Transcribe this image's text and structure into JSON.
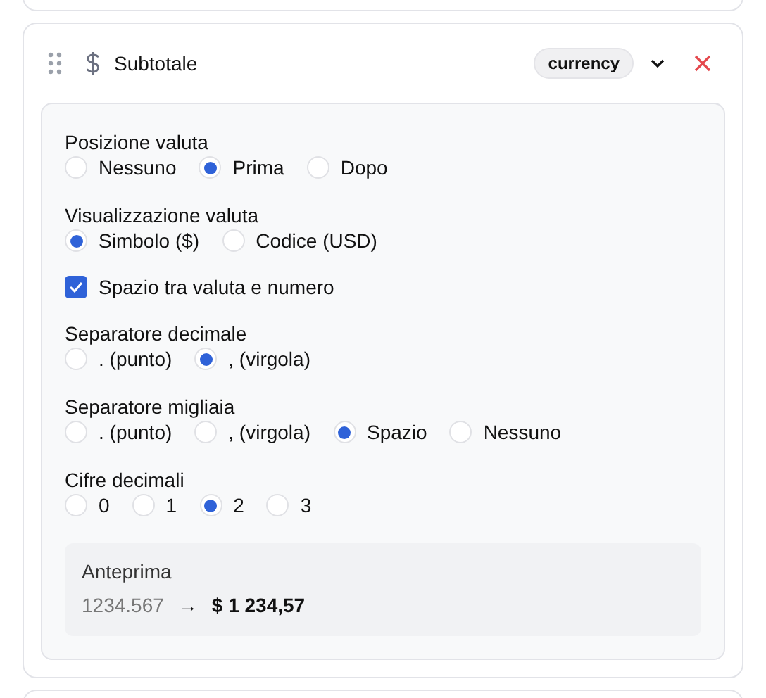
{
  "field": {
    "title": "Subtotale",
    "type_badge": "currency"
  },
  "settings": [
    {
      "kind": "radio",
      "label": "Posizione valuta",
      "options": [
        {
          "label": "Nessuno",
          "selected": false
        },
        {
          "label": "Prima",
          "selected": true
        },
        {
          "label": "Dopo",
          "selected": false
        }
      ]
    },
    {
      "kind": "radio",
      "label": "Visualizzazione valuta",
      "options": [
        {
          "label": "Simbolo ($)",
          "selected": true
        },
        {
          "label": "Codice (USD)",
          "selected": false
        }
      ]
    },
    {
      "kind": "checkbox",
      "label": "Spazio tra valuta e numero",
      "checked": true
    },
    {
      "kind": "radio",
      "label": "Separatore decimale",
      "options": [
        {
          "label": ". (punto)",
          "selected": false
        },
        {
          "label": ", (virgola)",
          "selected": true
        }
      ]
    },
    {
      "kind": "radio",
      "label": "Separatore migliaia",
      "options": [
        {
          "label": ". (punto)",
          "selected": false
        },
        {
          "label": ", (virgola)",
          "selected": false
        },
        {
          "label": "Spazio",
          "selected": true
        },
        {
          "label": "Nessuno",
          "selected": false
        }
      ]
    },
    {
      "kind": "radio",
      "label": "Cifre decimali",
      "options": [
        {
          "label": "0",
          "selected": false
        },
        {
          "label": "1",
          "selected": false
        },
        {
          "label": "2",
          "selected": true
        },
        {
          "label": "3",
          "selected": false
        }
      ]
    }
  ],
  "preview": {
    "label": "Anteprima",
    "input": "1234.567",
    "arrow": "→",
    "output": "$ 1 234,57"
  }
}
